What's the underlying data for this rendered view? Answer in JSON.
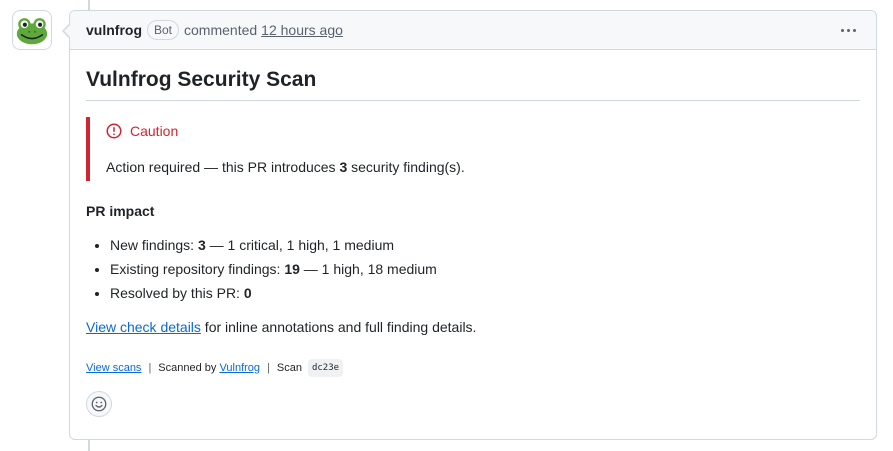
{
  "comment": {
    "author": "vulnfrog",
    "badge": "Bot",
    "action": "commented",
    "time": "12 hours ago",
    "menu_icon": "kebab-horizontal-icon"
  },
  "body": {
    "title": "Vulnfrog Security Scan",
    "alert": {
      "title": "Caution",
      "icon": "stop-circle-icon",
      "text_before": "Action required — this PR introduces ",
      "count": "3",
      "text_after": " security finding(s)."
    },
    "impact_heading": "PR impact",
    "items": [
      {
        "label": "New findings: ",
        "value": "3",
        "rest": " — 1 critical, 1 high, 1 medium"
      },
      {
        "label": "Existing repository findings: ",
        "value": "19",
        "rest": " — 1 high, 18 medium"
      },
      {
        "label": "Resolved by this PR: ",
        "value": "0",
        "rest": ""
      }
    ],
    "details_link": "View check details",
    "details_rest": " for inline annotations and full finding details."
  },
  "footer": {
    "view_scans": "View scans",
    "sep": "|",
    "scanned_by": "Scanned by ",
    "scanner_link": "Vulnfrog",
    "scan_label": "Scan",
    "scan_id": "dc23e"
  },
  "colors": {
    "danger": "#d1242f",
    "link": "#0969da",
    "border": "#d1d9e0",
    "header_bg": "#f6f8fa",
    "frog_green": "#5fa83b"
  }
}
